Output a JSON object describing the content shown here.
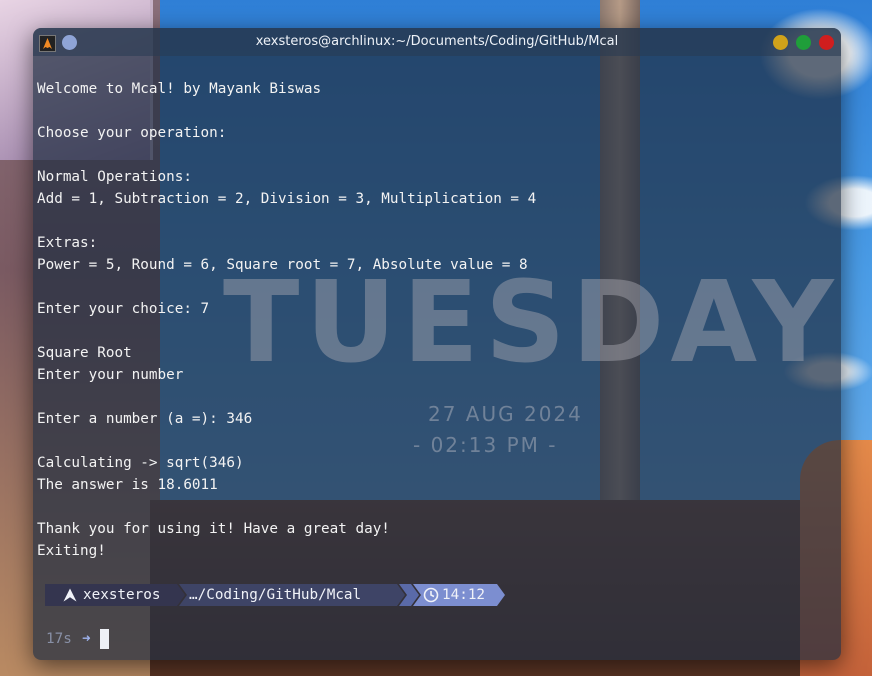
{
  "window": {
    "title": "xexsteros@archlinux:~/Documents/Coding/GitHub/Mcal"
  },
  "wallpaper": {
    "day": "TUESDAY",
    "date": "27 AUG 2024",
    "time": "- 02:13 PM -"
  },
  "terminal": {
    "lines": [
      "Welcome to Mcal! by Mayank Biswas",
      "",
      "Choose your operation:",
      "",
      "Normal Operations:",
      "Add = 1, Subtraction = 2, Division = 3, Multiplication = 4",
      "",
      "Extras:",
      "Power = 5, Round = 6, Square root = 7, Absolute value = 8",
      "",
      "Enter your choice: 7",
      "",
      "Square Root",
      "Enter your number",
      "",
      "Enter a number (a =): 346",
      "",
      "Calculating -> sqrt(346)",
      "The answer is 18.6011",
      "",
      "Thank you for using it! Have a great day!",
      "Exiting!"
    ]
  },
  "prompt": {
    "user": "xexsteros",
    "path": "…/Coding/GitHub/Mcal",
    "time": "14:12",
    "duration": "17s",
    "arrow": "➜"
  },
  "colors": {
    "minimize": "#d0a21a",
    "maximize": "#1f9e3a",
    "close": "#d01e1e",
    "terminal_text": "#f3f3f3",
    "prompt_user_bg": "#34354f",
    "prompt_path_bg": "#3e4466",
    "prompt_time_bg": "#7c8ed0"
  },
  "icons": {
    "app": "arch-terminal-icon",
    "pin": "pin-icon",
    "user": "arch-linux-icon",
    "clock": "clock-icon",
    "arrow": "arrow-right-icon"
  }
}
